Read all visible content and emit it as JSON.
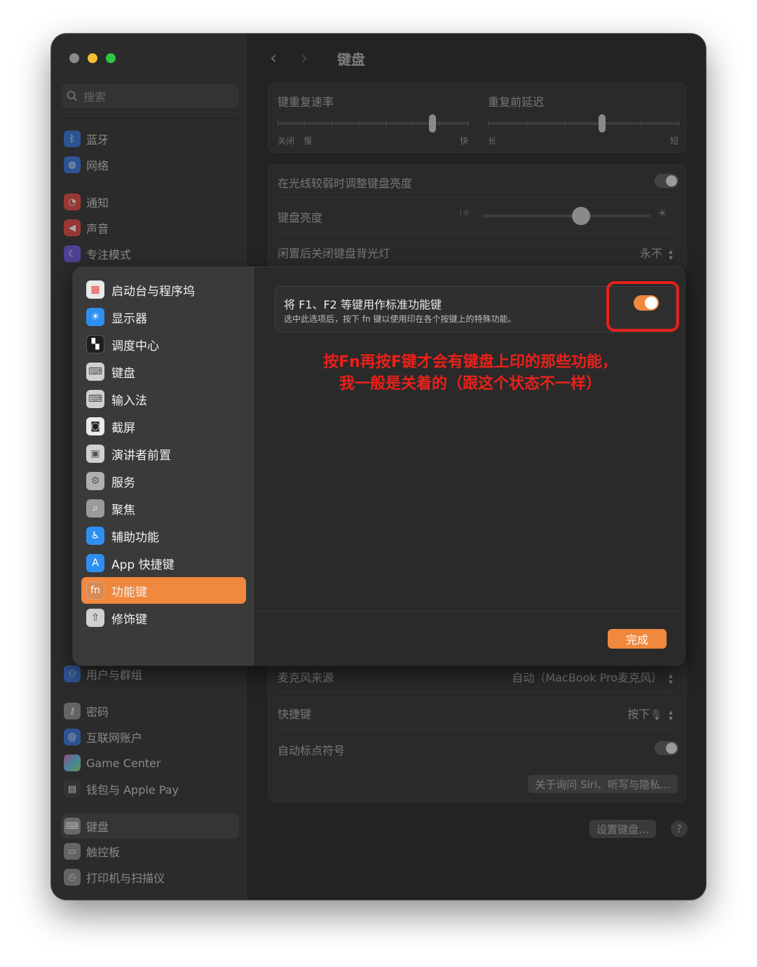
{
  "window": {
    "search_placeholder": "搜索",
    "page_title": "键盘"
  },
  "sidebar": {
    "items_top": [
      {
        "label": "蓝牙",
        "icon": "bluetooth-icon",
        "color": "#2f6fd8"
      },
      {
        "label": "网络",
        "icon": "globe-icon",
        "color": "#2f6fd8"
      },
      {
        "label": "通知",
        "icon": "bell-icon",
        "color": "#e0413a"
      },
      {
        "label": "声音",
        "icon": "speaker-icon",
        "color": "#e0413a"
      },
      {
        "label": "专注模式",
        "icon": "moon-icon",
        "color": "#6a4fd8"
      }
    ],
    "items_bottom": [
      {
        "label": "用户与群组",
        "icon": "users-icon",
        "color": "#2f6fd8"
      },
      {
        "label": "密码",
        "icon": "key-icon",
        "color": "#8a8a8a"
      },
      {
        "label": "互联网账户",
        "icon": "at-icon",
        "color": "#2f6fd8"
      },
      {
        "label": "Game Center",
        "icon": "game-center-icon",
        "color": "#c44fd8"
      },
      {
        "label": "钱包与 Apple Pay",
        "icon": "wallet-icon",
        "color": "#3a3a3a"
      },
      {
        "label": "键盘",
        "icon": "keyboard-icon",
        "color": "#8a8a8a"
      },
      {
        "label": "触控板",
        "icon": "trackpad-icon",
        "color": "#8a8a8a"
      },
      {
        "label": "打印机与扫描仪",
        "icon": "printer-icon",
        "color": "#8a8a8a"
      }
    ]
  },
  "main": {
    "repeat_rate_label": "键重复速率",
    "repeat_delay_label": "重复前延迟",
    "repeat_rate_min1": "关闭",
    "repeat_rate_min2": "慢",
    "repeat_rate_max": "快",
    "delay_min": "长",
    "delay_max": "短",
    "repeat_rate_value": 0.82,
    "delay_value": 0.6,
    "low_light_label": "在光线较弱时调整键盘亮度",
    "low_light_on": false,
    "brightness_label": "键盘亮度",
    "brightness_value": 0.6,
    "backlight_off_label": "闲置后关闭键盘背光灯",
    "backlight_off_value": "永不",
    "mic_source_label": "麦克风来源",
    "mic_source_value": "自动（MacBook Pro麦克风）",
    "shortcut_label": "快捷键",
    "shortcut_value": "按下",
    "auto_punct_label": "自动标点符号",
    "auto_punct_on": false,
    "siri_privacy_button": "关于询问 Siri、听写与隐私…",
    "setup_keyboard_button": "设置键盘…",
    "help_button": "?"
  },
  "sheet": {
    "items": [
      {
        "label": "启动台与程序坞",
        "icon": "launchpad-icon",
        "color": "#e9e9e9"
      },
      {
        "label": "显示器",
        "icon": "display-icon",
        "color": "#2f8ff0"
      },
      {
        "label": "调度中心",
        "icon": "mission-control-icon",
        "color": "#1e1e1e"
      },
      {
        "label": "键盘",
        "icon": "keyboard-icon",
        "color": "#d0d0d0"
      },
      {
        "label": "输入法",
        "icon": "input-source-icon",
        "color": "#d0d0d0"
      },
      {
        "label": "截屏",
        "icon": "screenshot-icon",
        "color": "#e9e9e9"
      },
      {
        "label": "演讲者前置",
        "icon": "presenter-icon",
        "color": "#d0d0d0"
      },
      {
        "label": "服务",
        "icon": "gears-icon",
        "color": "#b0b0b0"
      },
      {
        "label": "聚焦",
        "icon": "spotlight-icon",
        "color": "#9a9a9a"
      },
      {
        "label": "辅助功能",
        "icon": "accessibility-icon",
        "color": "#2f8ff0"
      },
      {
        "label": "App 快捷键",
        "icon": "app-store-icon",
        "color": "#2f8ff0"
      },
      {
        "label": "功能键",
        "icon": "fn-icon",
        "color": "#d68a55",
        "selected": true
      },
      {
        "label": "修饰键",
        "icon": "modifier-icon",
        "color": "#d0d0d0"
      }
    ],
    "fn_title": "将 F1、F2 等键用作标准功能键",
    "fn_subtitle": "选中此选项后，按下 fn 键以使用印在各个按键上的特殊功能。",
    "fn_toggle_on": true,
    "annotation_line1": "按Fn再按F键才会有键盘上印的那些功能，",
    "annotation_line2": "我一般是关着的（跟这个状态不一样）",
    "done_button": "完成",
    "accent_color": "#f0883e",
    "annotation_color": "#e8211a"
  }
}
